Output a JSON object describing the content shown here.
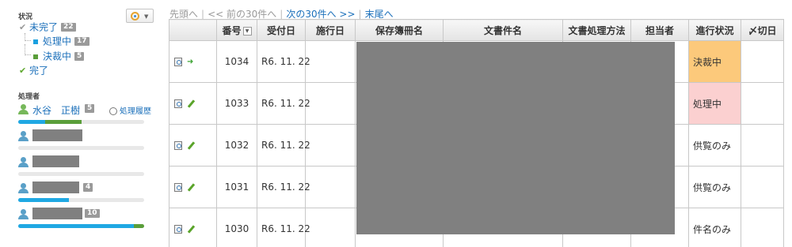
{
  "sidebar": {
    "status_title": "状況",
    "statuses": [
      {
        "label": "未完了",
        "count": "22",
        "indent": 0,
        "icon": "check-icon"
      },
      {
        "label": "処理中",
        "count": "17",
        "indent": 1,
        "icon": "blue-square-icon",
        "color": "#1aa0e0"
      },
      {
        "label": "決裁中",
        "count": "5",
        "indent": 1,
        "icon": "green-square-icon",
        "color": "#5a9e3a"
      },
      {
        "label": "完了",
        "count": "",
        "indent": 0,
        "icon": "green-check-icon",
        "color": "#5fa82f"
      }
    ],
    "processors_title": "処理者",
    "processors": [
      {
        "name": "水谷　正樹",
        "count": "5",
        "progress_blue": 0.21,
        "progress_green": 0.29,
        "icon": "person-icon-green"
      },
      {
        "name": "",
        "count": "",
        "progress_blue": 0,
        "progress_green": 0,
        "icon": "person-icon"
      },
      {
        "name": "",
        "count": "",
        "progress_blue": 0,
        "progress_green": 0,
        "icon": "person-icon"
      },
      {
        "name": "",
        "count": "4",
        "progress_blue": 0.4,
        "progress_green": 0,
        "icon": "person-icon"
      },
      {
        "name": "",
        "count": "10",
        "progress_blue": 0.92,
        "progress_green": 0.08,
        "icon": "person-icon"
      }
    ],
    "history_link": "処理履歴"
  },
  "pager": {
    "first": "先頭へ",
    "prev": "<< 前の30件へ",
    "next": "次の30件へ >>",
    "last": "末尾へ"
  },
  "table": {
    "headers": {
      "number": "番号",
      "received": "受付日",
      "enforced": "施行日",
      "ledger": "保存簿冊名",
      "title": "文書件名",
      "method": "文書処理方法",
      "assignee": "担当者",
      "progress": "進行状況",
      "deadline": "〆切日"
    },
    "rows": [
      {
        "action": "arrow-icon",
        "number": "1034",
        "received": "R6. 11. 22",
        "enforced": "",
        "progress": "決裁中",
        "progress_color": "#fcc97b",
        "deadline": ""
      },
      {
        "action": "pencil-icon",
        "number": "1033",
        "received": "R6. 11. 22",
        "enforced": "",
        "progress": "処理中",
        "progress_color": "#fbd0d0",
        "deadline": ""
      },
      {
        "action": "pencil-icon",
        "number": "1032",
        "received": "R6. 11. 22",
        "enforced": "",
        "progress": "供覧のみ",
        "progress_color": "",
        "deadline": ""
      },
      {
        "action": "pencil-icon",
        "number": "1031",
        "received": "R6. 11. 22",
        "enforced": "",
        "progress": "供覧のみ",
        "progress_color": "",
        "deadline": ""
      },
      {
        "action": "pencil-icon",
        "number": "1030",
        "received": "R6. 11. 22",
        "enforced": "",
        "progress": "件名のみ",
        "progress_color": "",
        "deadline": ""
      }
    ]
  },
  "colors": {
    "link": "#1a6fba",
    "progress_blue": "#1fa8e3",
    "progress_green": "#5a9e3a",
    "redaction": "#808080"
  }
}
